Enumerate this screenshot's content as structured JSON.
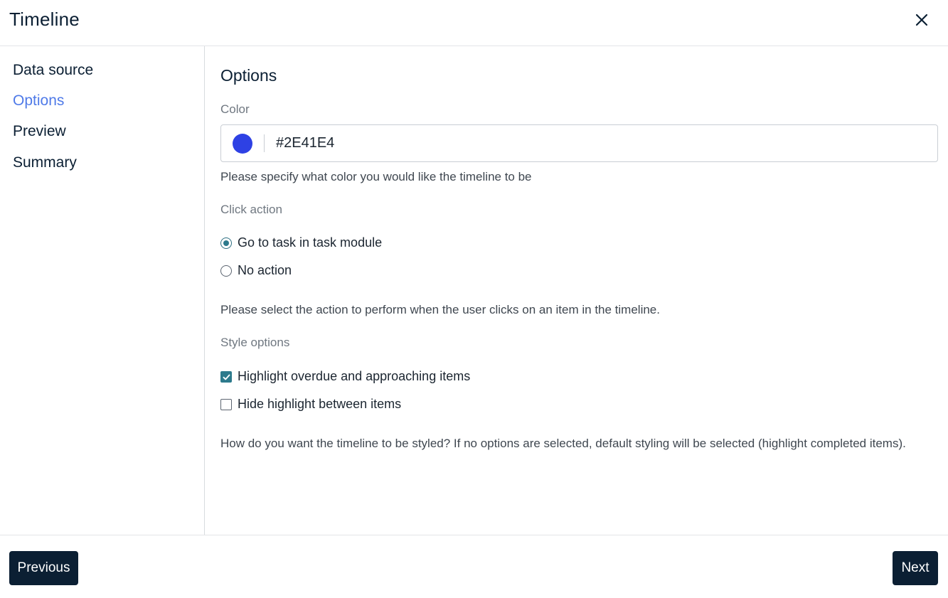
{
  "header": {
    "title": "Timeline",
    "close_icon": "close-icon"
  },
  "sidebar": {
    "items": [
      {
        "label": "Data source",
        "active": false
      },
      {
        "label": "Options",
        "active": true
      },
      {
        "label": "Preview",
        "active": false
      },
      {
        "label": "Summary",
        "active": false
      }
    ],
    "active_color": "#4F7AE8"
  },
  "main": {
    "title": "Options",
    "color": {
      "label": "Color",
      "value": "#2E41E4",
      "swatch": "#2E41E4",
      "help": "Please specify what color you would like the timeline to be"
    },
    "click_action": {
      "label": "Click action",
      "options": [
        {
          "label": "Go to task in task module",
          "selected": true
        },
        {
          "label": "No action",
          "selected": false
        }
      ],
      "help": "Please select the action to perform when the user clicks on an item in the timeline."
    },
    "style_options": {
      "label": "Style options",
      "options": [
        {
          "label": "Highlight overdue and approaching items",
          "checked": true
        },
        {
          "label": "Hide highlight between items",
          "checked": false
        }
      ],
      "help": "How do you want the timeline to be styled? If no options are selected, default styling will be selected (highlight completed items)."
    }
  },
  "footer": {
    "previous_label": "Previous",
    "next_label": "Next"
  },
  "colors": {
    "primary_dark": "#0B1F33",
    "check_accent": "#2D7A8C"
  }
}
